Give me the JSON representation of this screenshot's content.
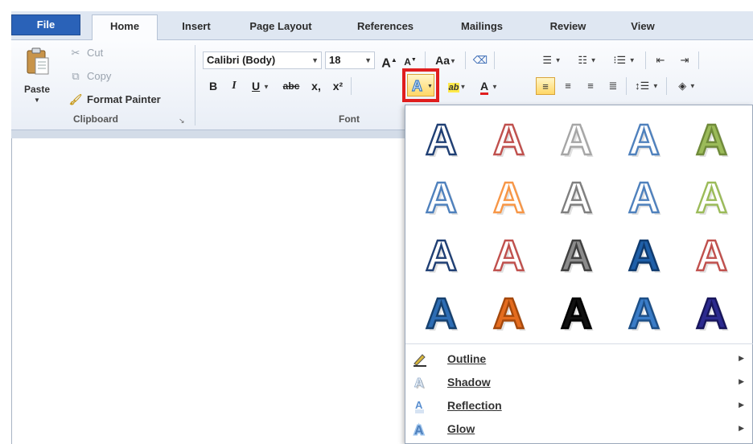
{
  "tabs": [
    "File",
    "Home",
    "Insert",
    "Page Layout",
    "References",
    "Mailings",
    "Review",
    "View"
  ],
  "clipboard": {
    "paste_label": "Paste",
    "cut_label": "Cut",
    "copy_label": "Copy",
    "format_painter_label": "Format Painter",
    "group_label": "Clipboard"
  },
  "font": {
    "font_name": "Calibri (Body)",
    "font_size": "18",
    "group_label": "Font",
    "bold": "B",
    "italic": "I",
    "underline": "U",
    "strikethrough": "abc",
    "subscript": "x,",
    "superscript": "x²",
    "grow": "A",
    "shrink": "A",
    "change_case": "Aa",
    "font_color_letter": "A",
    "highlight_glyph": "ab"
  },
  "text_effects_menu": {
    "items": [
      {
        "label": "Outline"
      },
      {
        "label": "Shadow"
      },
      {
        "label": "Reflection"
      },
      {
        "label": "Glow"
      }
    ],
    "gallery_letter": "A",
    "styles": [
      {
        "fill": "#ffffff",
        "stroke": "#1f3f74"
      },
      {
        "fill": "#ffffff",
        "stroke": "#c0504d"
      },
      {
        "fill": "#ffffff",
        "stroke": "#a6a6a6"
      },
      {
        "fill": "#ffffff",
        "stroke": "#4f81bd"
      },
      {
        "fill": "#9bbb59",
        "stroke": "#6f8a3a"
      },
      {
        "fill": "#ffffff",
        "stroke": "#4f81bd"
      },
      {
        "fill": "#ffffff",
        "stroke": "#f79646"
      },
      {
        "fill": "#ffffff",
        "stroke": "#7f7f7f"
      },
      {
        "fill": "#ffffff",
        "stroke": "#4f81bd"
      },
      {
        "fill": "#ffffff",
        "stroke": "#9bbb59"
      },
      {
        "fill": "#ffffff",
        "stroke": "#1f3f74"
      },
      {
        "fill": "#ffffff",
        "stroke": "#c0504d"
      },
      {
        "fill": "#8c8c8c",
        "stroke": "#404040"
      },
      {
        "fill": "#1f5fa8",
        "stroke": "#0f3a6e"
      },
      {
        "fill": "#ffffff",
        "stroke": "#c0504d"
      },
      {
        "fill": "#2e6db4",
        "stroke": "#16406e"
      },
      {
        "fill": "#e46c1f",
        "stroke": "#a4480c"
      },
      {
        "fill": "#111111",
        "stroke": "#000000"
      },
      {
        "fill": "#3a7cc7",
        "stroke": "#1c4e86"
      },
      {
        "fill": "#2c2a8f",
        "stroke": "#17155a"
      }
    ]
  },
  "colors": {
    "file_tab": "#2a62b8",
    "active_button": "#ffd766",
    "callout_border": "#e01e1e",
    "font_color_underline": "#e01e1e"
  }
}
